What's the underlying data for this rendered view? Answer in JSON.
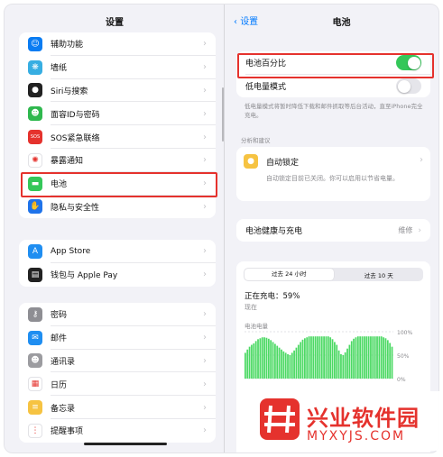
{
  "left": {
    "title": "设置",
    "group1": [
      {
        "label": "辅助功能",
        "icon": "accessibility-icon",
        "color": "#0a7cf2",
        "glyph": "☺"
      },
      {
        "label": "墙纸",
        "icon": "wallpaper-icon",
        "color": "#37aee2",
        "glyph": "❋"
      },
      {
        "label": "Siri与搜索",
        "icon": "siri-icon",
        "color": "#222222",
        "glyph": "●"
      },
      {
        "label": "面容ID与密码",
        "icon": "faceid-icon",
        "color": "#2fb84e",
        "glyph": "☻"
      },
      {
        "label": "SOS紧急联络",
        "icon": "sos-icon",
        "color": "#e5322d",
        "glyph": "SOS"
      },
      {
        "label": "暴露通知",
        "icon": "exposure-icon",
        "color": "#ffffff",
        "glyph": "✺"
      },
      {
        "label": "电池",
        "icon": "battery-icon",
        "color": "#34c759",
        "glyph": "▬"
      },
      {
        "label": "隐私与安全性",
        "icon": "privacy-hand-icon",
        "color": "#1f73ea",
        "glyph": "✋"
      }
    ],
    "group2": [
      {
        "label": "App Store",
        "icon": "appstore-icon",
        "color": "#1f8ef1",
        "glyph": "A"
      },
      {
        "label": "钱包与 Apple Pay",
        "icon": "wallet-icon",
        "color": "#222222",
        "glyph": "▤"
      }
    ],
    "group3": [
      {
        "label": "密码",
        "icon": "key-icon",
        "color": "#8e8e93",
        "glyph": "⚷"
      },
      {
        "label": "邮件",
        "icon": "mail-icon",
        "color": "#1f8ef1",
        "glyph": "✉"
      },
      {
        "label": "通讯录",
        "icon": "contacts-icon",
        "color": "#9c9ca0",
        "glyph": "☻"
      },
      {
        "label": "日历",
        "icon": "calendar-icon",
        "color": "#ffffff",
        "glyph": "▦"
      },
      {
        "label": "备忘录",
        "icon": "notes-icon",
        "color": "#f6c342",
        "glyph": "≡"
      },
      {
        "label": "提醒事项",
        "icon": "reminders-icon",
        "color": "#ffffff",
        "glyph": "⋮"
      }
    ]
  },
  "right": {
    "back_label": "设置",
    "title": "电池",
    "battery_percentage": {
      "label": "电池百分比",
      "on": true
    },
    "low_power": {
      "label": "低电量模式",
      "on": false
    },
    "low_power_note": "低电量模式将暂时降低下载和邮件抓取等后台活动，直至iPhone完全充电。",
    "insights": {
      "header": "分析和建议",
      "title": "自动锁定",
      "desc": "自动锁定目前已关闭。你可以启用以节省电量。"
    },
    "health": {
      "label": "电池健康与充电",
      "value": "维修"
    },
    "tabs": [
      "过去 24 小时",
      "过去 10 天"
    ],
    "charging_status": "正在充电：59%",
    "now": "现在",
    "level_title": "电池电量",
    "y_ticks": [
      "100%",
      "50%",
      "0%"
    ],
    "chart_data": {
      "type": "bar",
      "title": "电池电量",
      "ylim": [
        0,
        100
      ],
      "y_ticks": [
        "100%",
        "50%",
        "0%"
      ],
      "values": [
        55,
        62,
        68,
        72,
        75,
        80,
        84,
        86,
        88,
        88,
        87,
        85,
        82,
        78,
        74,
        70,
        66,
        62,
        58,
        55,
        52,
        50,
        55,
        60,
        66,
        72,
        78,
        83,
        86,
        88,
        90,
        90,
        90,
        90,
        90,
        90,
        90,
        90,
        90,
        90,
        88,
        84,
        78,
        72,
        60,
        52,
        50,
        56,
        64,
        72,
        80,
        85,
        88,
        90,
        90,
        90,
        90,
        90,
        90,
        90,
        90,
        90,
        90,
        90,
        90,
        88,
        86,
        82,
        76,
        68
      ]
    }
  },
  "watermark": {
    "cn": "兴业软件园",
    "en": "MYXYJS.COM",
    "color": "#e5322d"
  }
}
